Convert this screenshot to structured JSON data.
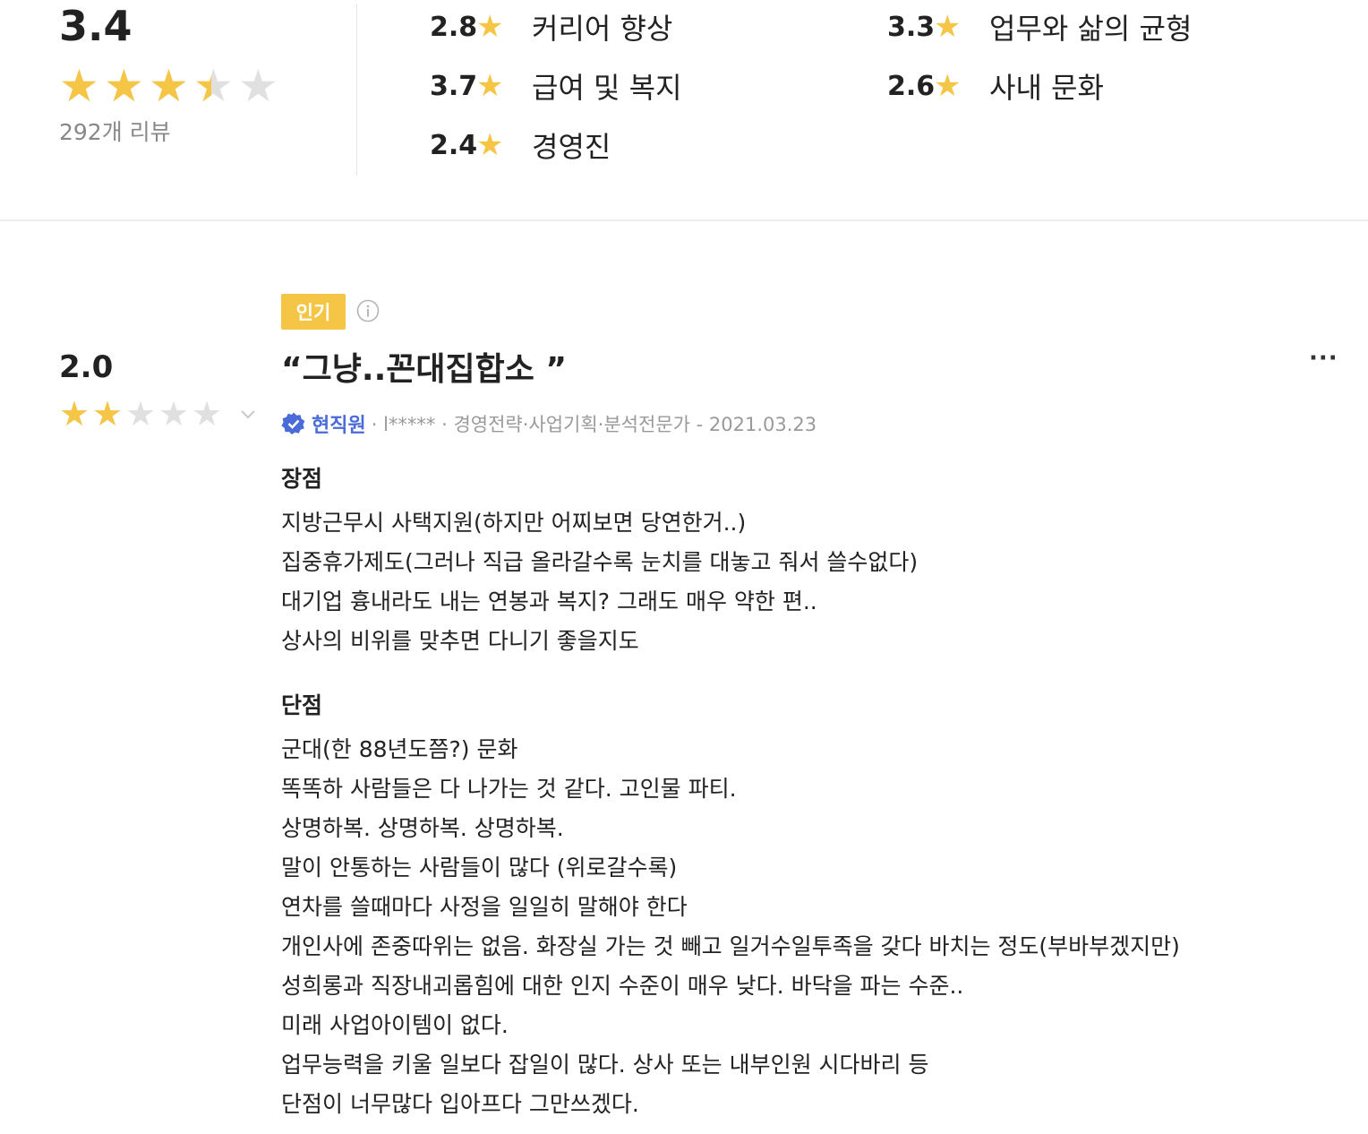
{
  "summary": {
    "overall_score": "3.4",
    "overall_rating": 3.4,
    "review_count": "292개 리뷰",
    "categories": [
      {
        "score": "2.8",
        "name": "커리어 향상"
      },
      {
        "score": "3.3",
        "name": "업무와 삶의 균형"
      },
      {
        "score": "3.7",
        "name": "급여 및 복지"
      },
      {
        "score": "2.6",
        "name": "사내 문화"
      },
      {
        "score": "2.4",
        "name": "경영진"
      }
    ]
  },
  "review": {
    "badge": "인기",
    "score": "2.0",
    "rating": 2.0,
    "title": "“그냥..꼰대집합소 ”",
    "status": "현직원",
    "meta_text": "· l***** · 경영전략·사업기획·분석전문가 - 2021.03.23",
    "pros_title": "장점",
    "pros": [
      "지방근무시 사택지원(하지만 어찌보면 당연한거..)",
      "집중휴가제도(그러나 직급 올라갈수록 눈치를 대놓고 줘서 쓸수없다)",
      "대기업 흉내라도 내는 연봉과 복지? 그래도 매우 약한 편..",
      "상사의 비위를 맞추면 다니기 좋을지도"
    ],
    "cons_title": "단점",
    "cons": [
      "군대(한 88년도쯤?) 문화",
      "똑똑하 사람들은 다 나가는 것 같다. 고인물 파티.",
      "상명하복. 상명하복. 상명하복.",
      "말이 안통하는 사람들이 많다 (위로갈수록)",
      "연차를 쓸때마다 사정을 일일히 말해야 한다",
      "개인사에 존중따위는 없음. 화장실 가는 것 빼고 일거수일투족을 갖다 바치는 정도(부바부겠지만)",
      "성희롱과 직장내괴롭힘에 대한 인지 수준이 매우 낮다. 바닥을 파는 수준..",
      "미래 사업아이템이 없다.",
      "업무능력을 키울 일보다 잡일이 많다. 상사 또는 내부인원 시다바리 등",
      "단점이 너무많다 입아프다 그만쓰겠다."
    ]
  },
  "icons": {
    "star": "star-icon",
    "info": "info-icon",
    "verified": "verified-badge-icon",
    "chevron": "chevron-down-icon",
    "more": "more-options-icon"
  },
  "colors": {
    "star_filled": "#f5c646",
    "star_empty": "#e0e0e0",
    "badge_bg": "#f5c646",
    "verified": "#4a6bd8",
    "muted_text": "#9a9a9a"
  }
}
